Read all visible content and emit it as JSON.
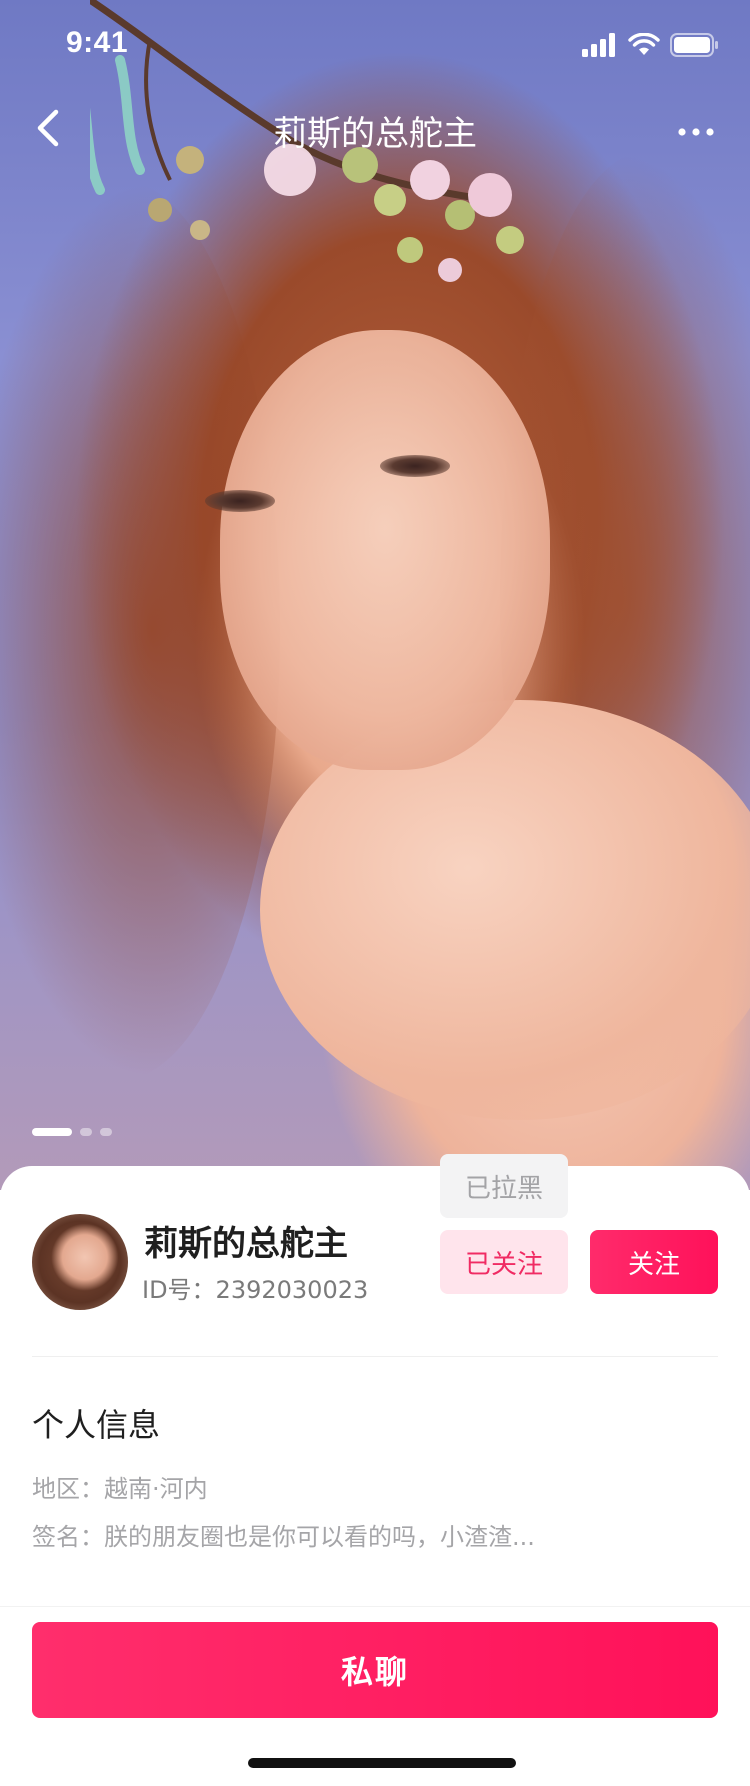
{
  "status_bar": {
    "time": "9:41",
    "icons": [
      "cellular-signal-icon",
      "wifi-icon",
      "battery-icon"
    ]
  },
  "nav": {
    "title": "莉斯的总舵主",
    "back_icon": "chevron-left-icon",
    "more_icon": "more-horizontal-icon"
  },
  "hero": {
    "image": "profile-photo",
    "pages_total": 3,
    "active_page": 1
  },
  "profile": {
    "name": "莉斯的总舵主",
    "id_text": "ID号：2392030023"
  },
  "actions": {
    "blacklisted_label": "已拉黑",
    "followed_label": "已关注",
    "follow_label": "关注",
    "chat_label": "私聊"
  },
  "personal_info": {
    "title": "个人信息",
    "region": "地区：越南·河内",
    "signature": "签名：朕的朋友圈也是你可以看的吗，小渣渣..."
  },
  "colors": {
    "accent": "#ff1a5f",
    "followed_bg": "#ffe4ec",
    "blacklisted_bg": "#f3f3f4"
  }
}
